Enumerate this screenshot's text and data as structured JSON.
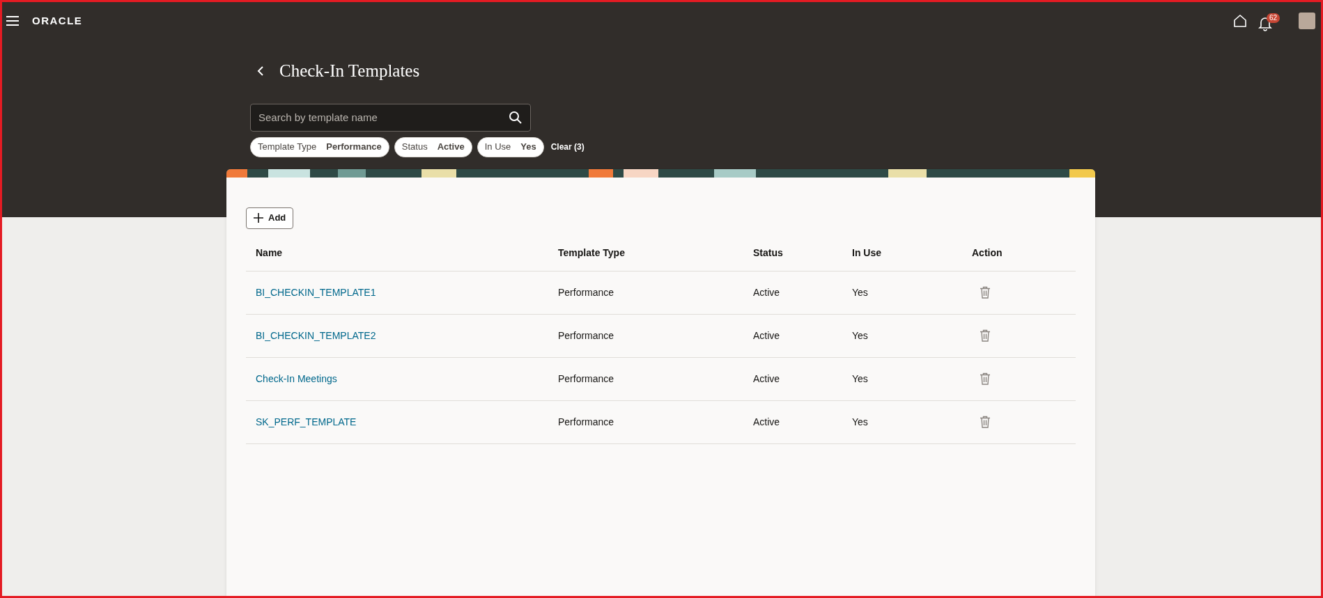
{
  "header": {
    "logo": "ORACLE",
    "notification_count": "62"
  },
  "page": {
    "title": "Check-In Templates"
  },
  "search": {
    "placeholder": "Search by template name"
  },
  "filters": [
    {
      "label": "Template Type",
      "value": "Performance"
    },
    {
      "label": "Status",
      "value": "Active"
    },
    {
      "label": "In Use",
      "value": "Yes"
    }
  ],
  "clear_filters": "Clear (3)",
  "add_button": "Add",
  "table": {
    "columns": [
      "Name",
      "Template Type",
      "Status",
      "In Use",
      "Action"
    ],
    "rows": [
      {
        "name": "BI_CHECKIN_TEMPLATE1",
        "template_type": "Performance",
        "status": "Active",
        "in_use": "Yes"
      },
      {
        "name": "BI_CHECKIN_TEMPLATE2",
        "template_type": "Performance",
        "status": "Active",
        "in_use": "Yes"
      },
      {
        "name": "Check-In Meetings",
        "template_type": "Performance",
        "status": "Active",
        "in_use": "Yes"
      },
      {
        "name": "SK_PERF_TEMPLATE",
        "template_type": "Performance",
        "status": "Active",
        "in_use": "Yes"
      }
    ]
  }
}
